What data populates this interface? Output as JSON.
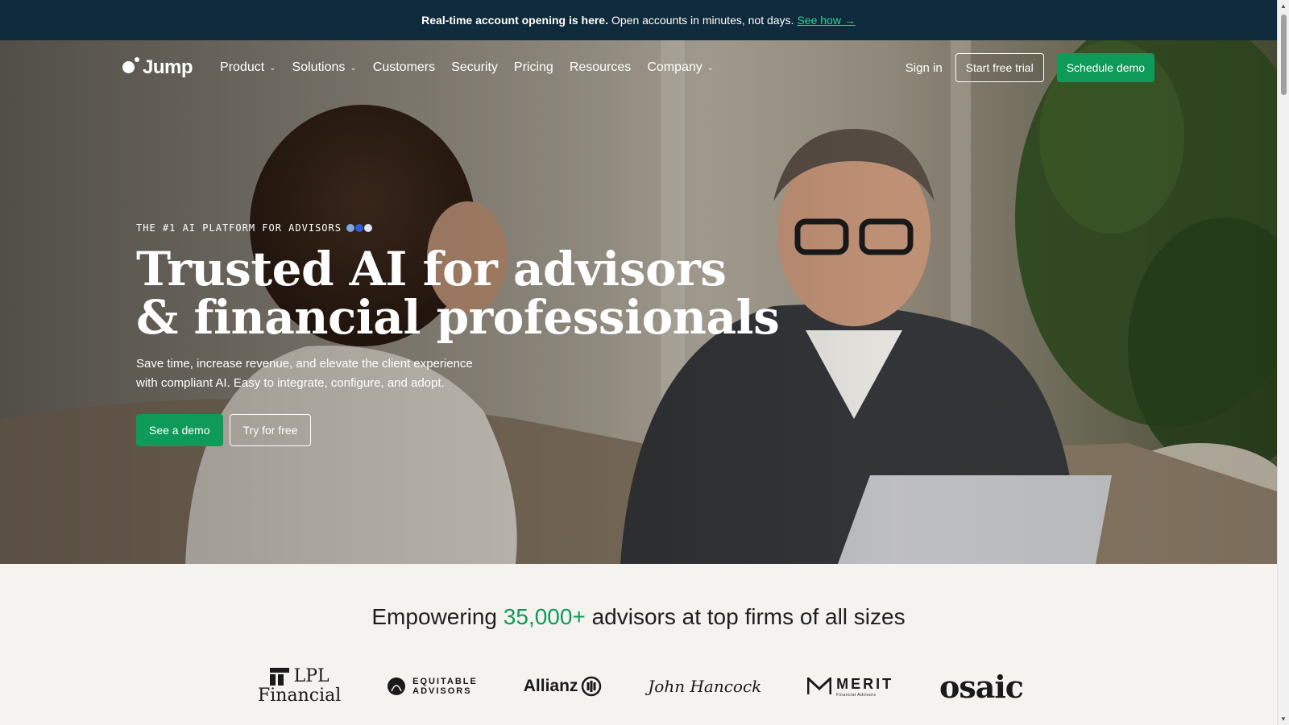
{
  "announcement": {
    "bold": "Real-time account opening is here.",
    "text": "Open accounts in minutes, not days.",
    "link": "See how →"
  },
  "nav": {
    "logo": "Jump",
    "items": [
      {
        "label": "Product",
        "dropdown": true
      },
      {
        "label": "Solutions",
        "dropdown": true
      },
      {
        "label": "Customers",
        "dropdown": false
      },
      {
        "label": "Security",
        "dropdown": false
      },
      {
        "label": "Pricing",
        "dropdown": false
      },
      {
        "label": "Resources",
        "dropdown": false
      },
      {
        "label": "Company",
        "dropdown": true
      }
    ],
    "signin": "Sign in",
    "trial": "Start free trial",
    "schedule": "Schedule demo"
  },
  "hero": {
    "eyebrow": "THE #1 AI PLATFORM FOR ADVISORS",
    "headline_line1": "Trusted AI for advisors",
    "headline_line2": "& financial professionals",
    "subtitle_line1": "Save time, increase revenue, and elevate the client experience",
    "subtitle_line2": "with compliant AI. Easy to integrate, configure, and adopt.",
    "cta_primary": "See a demo",
    "cta_secondary": "Try for free"
  },
  "logos": {
    "heading_pre": "Empowering",
    "heading_highlight": "35,000+",
    "heading_post": "advisors at top firms of all sizes",
    "firms": {
      "lpl_1": "LPL",
      "lpl_2": "Financial",
      "equitable_1": "EQUITABLE",
      "equitable_2": "ADVISORS",
      "allianz": "Allianz",
      "john_hancock": "John Hancock",
      "merit": "MERIT",
      "merit_sub": "Financial Advisors",
      "osaic": "osaic"
    }
  },
  "colors": {
    "accent": "#0e9a59",
    "announcement_bg": "#0f2a3a",
    "highlight_text": "#0e9a59",
    "section_bg": "#f4f3ef"
  }
}
